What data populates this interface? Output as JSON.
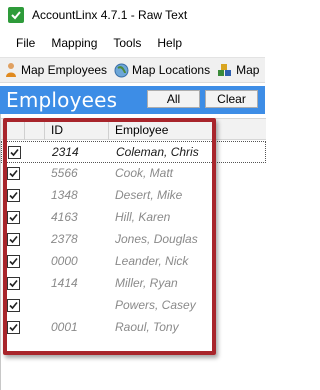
{
  "window": {
    "title": "AccountLinx 4.7.1 - Raw Text"
  },
  "menu": [
    "File",
    "Mapping",
    "Tools",
    "Help"
  ],
  "toolbar": {
    "map_employees": "Map Employees",
    "map_locations": "Map Locations",
    "map_third": "Map"
  },
  "panel": {
    "title": "Employees",
    "all_label": "All",
    "clear_label": "Clear"
  },
  "grid": {
    "columns": {
      "id": "ID",
      "employee": "Employee"
    },
    "rows": [
      {
        "checked": true,
        "id": "2314",
        "employee": "Coleman, Chris",
        "selected": true
      },
      {
        "checked": true,
        "id": "5566",
        "employee": "Cook, Matt"
      },
      {
        "checked": true,
        "id": "1348",
        "employee": "Desert, Mike"
      },
      {
        "checked": true,
        "id": "4163",
        "employee": "Hill, Karen"
      },
      {
        "checked": true,
        "id": "2378",
        "employee": "Jones, Douglas"
      },
      {
        "checked": true,
        "id": "0000",
        "employee": "Leander, Nick"
      },
      {
        "checked": true,
        "id": "1414",
        "employee": "Miller, Ryan"
      },
      {
        "checked": true,
        "id": "",
        "employee": "Powers, Casey"
      },
      {
        "checked": true,
        "id": "0001",
        "employee": "Raoul, Tony"
      }
    ]
  },
  "colors": {
    "header_blue": "#3d8de6",
    "highlight_red": "#a8252b"
  }
}
